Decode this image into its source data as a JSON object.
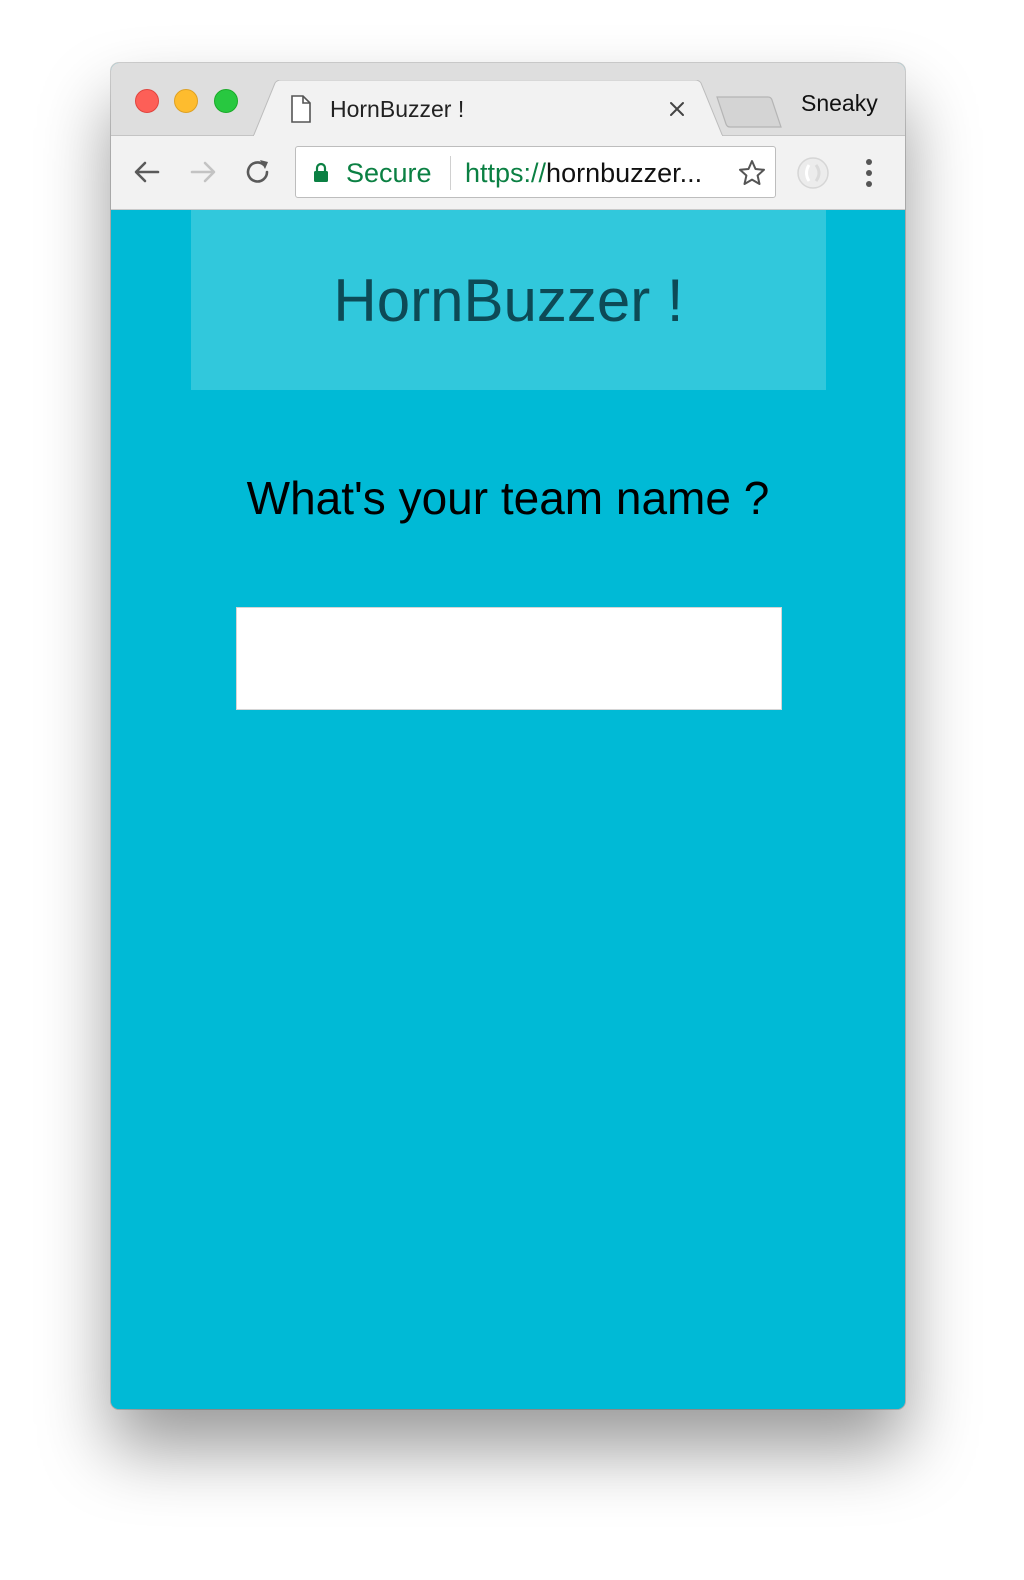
{
  "browser": {
    "tab_title": "HornBuzzer !",
    "profile_name": "Sneaky",
    "security_label": "Secure",
    "url_scheme": "https://",
    "url_rest": "hornbuzzer..."
  },
  "page": {
    "app_title": "HornBuzzer !",
    "question": "What's your team name ?",
    "team_input": {
      "value": "",
      "placeholder": ""
    }
  },
  "colors": {
    "page_background": "#00bad6",
    "header_background": "#31c8dc",
    "title_text": "#0d4a56",
    "secure_green": "#0b8043"
  },
  "icons": {
    "traffic_lights": [
      "close-icon",
      "minimize-icon",
      "maximize-icon"
    ],
    "tab": [
      "document-icon",
      "close-icon"
    ],
    "toolbar": [
      "back-arrow-icon",
      "forward-arrow-icon",
      "reload-icon",
      "lock-icon",
      "star-icon",
      "extension-icon",
      "kebab-menu-icon"
    ]
  }
}
